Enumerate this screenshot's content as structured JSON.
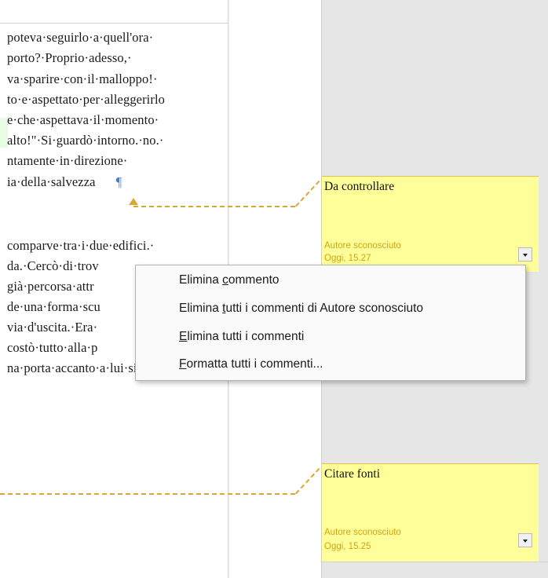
{
  "document": {
    "lines": [
      "poteva·seguirlo·a·quell'ora·",
      "porto?·Proprio·adesso,·",
      "va·sparire·con·il·malloppo!·",
      "to·e·aspettato·per·alleggerirlo",
      "e·che·aspettava·il·momento·",
      "alto!\"·Si·guardò·intorno.·no.·",
      "ntamente·in·direzione·",
      "ia·della·salvezza"
    ],
    "pilcrow": "¶",
    "lines2": [
      "comparve·tra·i·due·edifici.·",
      "da.·Cercò·di·trov",
      "già·percorsa·attr",
      "de·una·forma·scu",
      "via·d'uscita.·Era·",
      "costò·tutto·alla·p",
      "na·porta·accanto·a·lui·si·aprì·"
    ]
  },
  "comments": [
    {
      "title": "Da controllare",
      "author": "Autore sconosciuto",
      "date": "Oggi, 15.27"
    },
    {
      "title": "Citare fonti",
      "author": "Autore sconosciuto",
      "date": "Oggi, 15.25"
    }
  ],
  "context_menu": {
    "items": [
      {
        "pre": "Elimina ",
        "u": "c",
        "post": "ommento"
      },
      {
        "pre": "Elimina ",
        "u": "t",
        "post": "utti i commenti di Autore sconosciuto"
      },
      {
        "pre": "",
        "u": "E",
        "post": "limina tutti i commenti"
      },
      {
        "pre": "",
        "u": "F",
        "post": "ormatta tutti i commenti..."
      }
    ]
  },
  "colors": {
    "comment_bg": "#ffff99",
    "anchor": "#d9a831",
    "comment_meta": "#d2a20d",
    "pilcrow": "#3f7fd2"
  },
  "icons": {
    "comment_menu": "chevron-down-icon",
    "anchor": "anchor-triangle-icon"
  }
}
